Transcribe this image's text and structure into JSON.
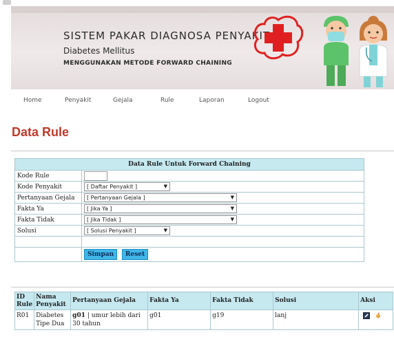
{
  "header": {
    "title": "SISTEM PAKAR DIAGNOSA PENYAKIT",
    "subtitle": "Diabetes Mellitus",
    "method": "MENGGUNAKAN METODE FORWARD CHAINING"
  },
  "nav": [
    "Home",
    "Penyakit",
    "Gejala",
    "Rule",
    "Laporan",
    "Logout"
  ],
  "page_title": "Data Rule",
  "form": {
    "heading": "Data Rule Untuk Forward Chaining",
    "labels": {
      "kode_rule": "Kode Rule",
      "kode_penyakit": "Kode Penyakit",
      "pertanyaan_gejala": "Pertanyaan Gejala",
      "fakta_ya": "Fakta Ya",
      "fakta_tidak": "Fakta Tidak",
      "solusi": "Solusi"
    },
    "selects": {
      "kode_penyakit": "[ Daftar Penyakit ]",
      "pertanyaan_gejala": "[ Pertanyaan Gejala ]",
      "fakta_ya": "[ Jika Ya ]",
      "fakta_tidak": "[ Jika Tidak ]",
      "solusi": "[ Solusi Penyakit ]"
    },
    "kode_rule_value": "",
    "buttons": {
      "save": "Simpan",
      "reset": "Reset"
    }
  },
  "table": {
    "headers": {
      "id": "ID Rule",
      "nama": "Nama Penyakit",
      "pertanyaan": "Pertanyaan Gejala",
      "ya": "Fakta Ya",
      "tidak": "Fakta Tidak",
      "solusi": "Solusi",
      "aksi": "Aksi"
    },
    "rows": [
      {
        "id": "R01",
        "nama": "Diabetes Tipe Dua",
        "kode_gejala": "g01",
        "pertanyaan": " | umur lebih dari 30 tahun",
        "ya": "g01",
        "tidak": "g19",
        "solusi": "lanj"
      }
    ]
  },
  "colors": {
    "accent_title": "#c0392b",
    "table_header": "#c6e9f0",
    "button": "#3fb7e8"
  }
}
